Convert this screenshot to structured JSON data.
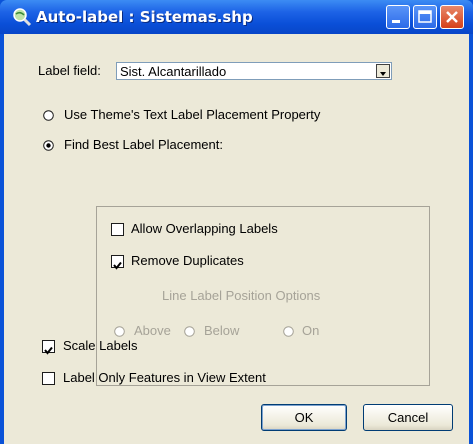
{
  "window": {
    "title": "Auto-label : Sistemas.shp"
  },
  "label_field": {
    "label": "Label field:",
    "value": "Sist. Alcantarillado"
  },
  "placement": {
    "option_theme": "Use Theme's Text Label Placement Property",
    "option_best": "Find Best Label Placement:",
    "selected": "best"
  },
  "best_options": {
    "allow_overlapping": {
      "label": "Allow Overlapping Labels",
      "checked": false
    },
    "remove_duplicates": {
      "label": "Remove Duplicates",
      "checked": true
    },
    "line_position": {
      "title": "Line Label Position Options",
      "above": "Above",
      "below": "Below",
      "on": "On",
      "enabled": false
    }
  },
  "scale_labels": {
    "label": "Scale Labels",
    "checked": true
  },
  "label_only_view": {
    "label": "Label Only Features in View Extent",
    "checked": false
  },
  "buttons": {
    "ok": "OK",
    "cancel": "Cancel"
  },
  "icons": {
    "title": "magnifier-globe-icon"
  },
  "colors": {
    "titlebar": "#0a52d8",
    "dialog_bg": "#ece9d8",
    "disabled_text": "#a6a398",
    "close_btn": "#d5401a"
  }
}
